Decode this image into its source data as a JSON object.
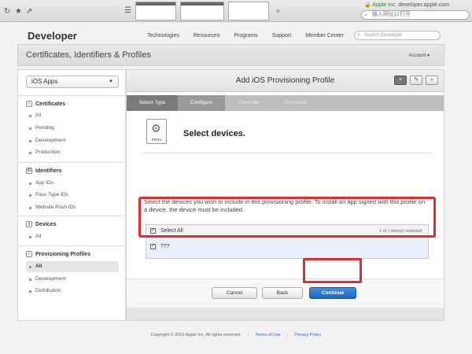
{
  "browser": {
    "site_name": "Apple Inc.",
    "domain": "developer.apple.com",
    "url_placeholder": "输入网址以打开"
  },
  "header": {
    "brand": "Developer",
    "nav": [
      "Technologies",
      "Resources",
      "Programs",
      "Support",
      "Member Center"
    ],
    "search_placeholder": "Search Developer"
  },
  "titlebar": {
    "title": "Certificates, Identifiers & Profiles",
    "account": "Account ▾"
  },
  "sidebar": {
    "platform": "iOS Apps",
    "sections": [
      {
        "title": "Certificates",
        "items": [
          "All",
          "Pending",
          "Development",
          "Production"
        ]
      },
      {
        "title": "Identifiers",
        "items": [
          "App IDs",
          "Pass Type IDs",
          "Website Push IDs"
        ]
      },
      {
        "title": "Devices",
        "items": [
          "All"
        ]
      },
      {
        "title": "Provisioning Profiles",
        "items": [
          "All",
          "Development",
          "Distribution"
        ]
      }
    ]
  },
  "main": {
    "title": "Add iOS Provisioning Profile",
    "steps": [
      "Select Type",
      "Configure",
      "Generate",
      "Download"
    ],
    "prov_label": "PROV",
    "heading": "Select devices.",
    "description": "Select the devices you wish to include in this provisioning profile. To install an app signed with this profile on a device, the device must be included.",
    "table": {
      "select_all": "Select All",
      "count": "1 of 1 item(s) selected",
      "rows": [
        "???"
      ]
    },
    "buttons": {
      "cancel": "Cancel",
      "back": "Back",
      "continue": "Continue"
    }
  },
  "footer": {
    "copyright": "Copyright © 2013 Apple Inc. All rights reserved.",
    "terms": "Terms of Use",
    "privacy": "Privacy Policy"
  },
  "colors": {
    "accent": "#1b67c4",
    "highlight": "#d63030"
  }
}
